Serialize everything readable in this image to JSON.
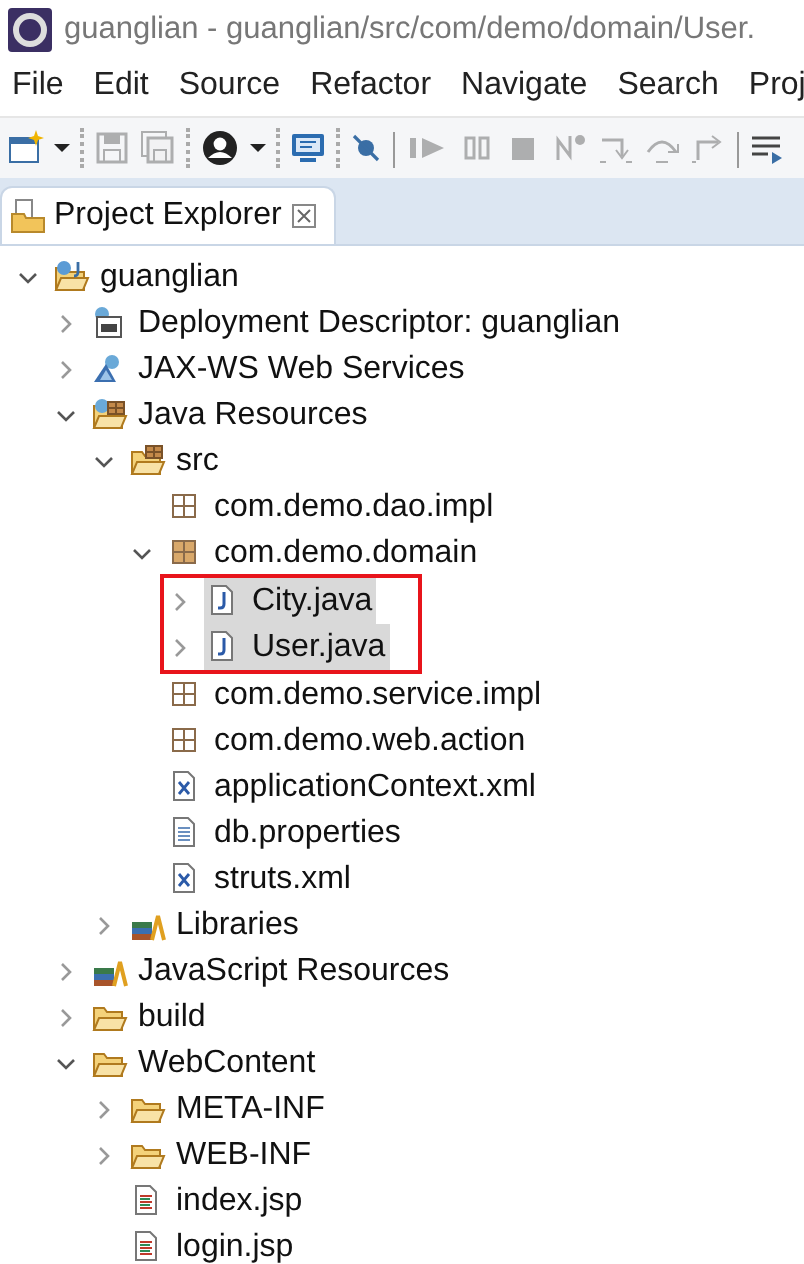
{
  "window": {
    "title": "guanglian - guanglian/src/com/demo/domain/User."
  },
  "menu": [
    {
      "label": "File"
    },
    {
      "label": "Edit"
    },
    {
      "label": "Source"
    },
    {
      "label": "Refactor"
    },
    {
      "label": "Navigate"
    },
    {
      "label": "Search"
    },
    {
      "label": "Proj"
    }
  ],
  "toolbar": [
    {
      "kind": "new",
      "disabled": false
    },
    {
      "kind": "dropdown",
      "disabled": false
    },
    {
      "kind": "sep"
    },
    {
      "kind": "save",
      "disabled": true
    },
    {
      "kind": "saveall",
      "disabled": true
    },
    {
      "kind": "sep"
    },
    {
      "kind": "person",
      "disabled": false
    },
    {
      "kind": "dropdown",
      "disabled": false
    },
    {
      "kind": "sep"
    },
    {
      "kind": "monitor",
      "disabled": false
    },
    {
      "kind": "sep"
    },
    {
      "kind": "skip",
      "disabled": false
    },
    {
      "kind": "bar"
    },
    {
      "kind": "resume",
      "disabled": true
    },
    {
      "kind": "suspend",
      "disabled": true
    },
    {
      "kind": "stop",
      "disabled": true
    },
    {
      "kind": "disconnect",
      "disabled": true
    },
    {
      "kind": "stepinto",
      "disabled": true
    },
    {
      "kind": "stepover",
      "disabled": true
    },
    {
      "kind": "stepreturn",
      "disabled": true
    },
    {
      "kind": "bar"
    },
    {
      "kind": "lines",
      "disabled": false
    }
  ],
  "view_tab": {
    "label": "Project Explorer"
  },
  "tree": [
    {
      "label": "guanglian",
      "kind": "project",
      "expanded": true,
      "selected": false,
      "children": [
        {
          "label": "Deployment Descriptor: guanglian",
          "kind": "descriptor",
          "expanded": false,
          "selected": false
        },
        {
          "label": "JAX-WS Web Services",
          "kind": "webservice",
          "expanded": false,
          "selected": false
        },
        {
          "label": "Java Resources",
          "kind": "javares",
          "expanded": true,
          "selected": false,
          "children": [
            {
              "label": "src",
              "kind": "srcfolder",
              "expanded": true,
              "selected": false,
              "children": [
                {
                  "label": "com.demo.dao.impl",
                  "kind": "package",
                  "selected": false
                },
                {
                  "label": "com.demo.domain",
                  "kind": "package-full",
                  "expanded": true,
                  "selected": false,
                  "children_outlined": true,
                  "children": [
                    {
                      "label": "City.java",
                      "kind": "java",
                      "expanded": false,
                      "selected": true
                    },
                    {
                      "label": "User.java",
                      "kind": "java",
                      "expanded": false,
                      "selected": true
                    }
                  ]
                },
                {
                  "label": "com.demo.service.impl",
                  "kind": "package",
                  "selected": false
                },
                {
                  "label": "com.demo.web.action",
                  "kind": "package",
                  "selected": false
                },
                {
                  "label": "applicationContext.xml",
                  "kind": "xml",
                  "selected": false
                },
                {
                  "label": "db.properties",
                  "kind": "text",
                  "selected": false
                },
                {
                  "label": "struts.xml",
                  "kind": "xml",
                  "selected": false
                }
              ]
            },
            {
              "label": "Libraries",
              "kind": "library",
              "expanded": false,
              "selected": false
            }
          ]
        },
        {
          "label": "JavaScript Resources",
          "kind": "library",
          "expanded": false,
          "selected": false
        },
        {
          "label": "build",
          "kind": "folder",
          "expanded": false,
          "selected": false
        },
        {
          "label": "WebContent",
          "kind": "folder",
          "expanded": true,
          "selected": false,
          "children": [
            {
              "label": "META-INF",
              "kind": "folder",
              "expanded": false,
              "selected": false
            },
            {
              "label": "WEB-INF",
              "kind": "folder",
              "expanded": false,
              "selected": false
            },
            {
              "label": "index.jsp",
              "kind": "jsp",
              "selected": false
            },
            {
              "label": "login.jsp",
              "kind": "jsp",
              "selected": false
            }
          ]
        }
      ]
    }
  ]
}
